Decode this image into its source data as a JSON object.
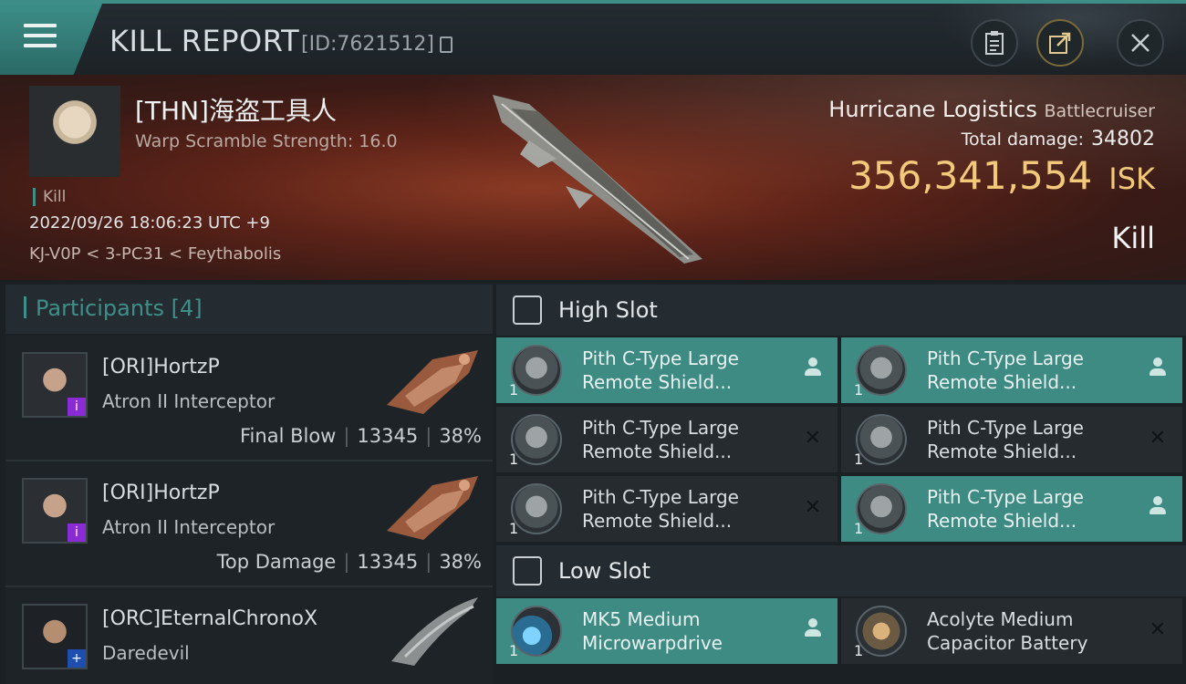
{
  "header": {
    "title": "KILL REPORT",
    "report_id": "[ID:7621512]",
    "icons": [
      "menu-icon",
      "clipboard-icon",
      "share-icon",
      "close-icon"
    ]
  },
  "victim": {
    "name": "[THN]海盗工具人",
    "scramble": "Warp Scramble Strength: 16.0",
    "tag": "Kill",
    "date": "2022/09/26 18:06:23 UTC +9",
    "location": "KJ-V0P < 3-PC31 < Feythabolis",
    "ship_name": "Hurricane Logistics",
    "ship_class": "Battlecruiser",
    "total_damage_label": "Total damage:",
    "total_damage": "34802",
    "isk_value": "356,341,554",
    "isk_unit": "ISK",
    "result": "Kill"
  },
  "participants": {
    "label": "Participants",
    "count": "[4]",
    "rows": [
      {
        "name": "[ORI]HortzP",
        "ship": "Atron II Interceptor",
        "role": "Final Blow",
        "damage": "13345",
        "percent": "38%",
        "badge": "i"
      },
      {
        "name": "[ORI]HortzP",
        "ship": "Atron II Interceptor",
        "role": "Top Damage",
        "damage": "13345",
        "percent": "38%",
        "badge": "i"
      },
      {
        "name": "[ORC]EternalChronoX",
        "ship": "Daredevil",
        "role": "",
        "damage": "",
        "percent": "",
        "badge": "+"
      }
    ]
  },
  "high_slot": {
    "title": "High Slot",
    "modules": [
      {
        "line1": "Pith C-Type Large",
        "line2": "Remote Shield...",
        "qty": "1",
        "status": "fitted"
      },
      {
        "line1": "Pith C-Type Large",
        "line2": "Remote Shield...",
        "qty": "1",
        "status": "fitted"
      },
      {
        "line1": "Pith C-Type Large",
        "line2": "Remote Shield...",
        "qty": "1",
        "status": "destroyed"
      },
      {
        "line1": "Pith C-Type Large",
        "line2": "Remote Shield...",
        "qty": "1",
        "status": "destroyed"
      },
      {
        "line1": "Pith C-Type Large",
        "line2": "Remote Shield...",
        "qty": "1",
        "status": "destroyed"
      },
      {
        "line1": "Pith C-Type Large",
        "line2": "Remote Shield...",
        "qty": "1",
        "status": "fitted"
      }
    ]
  },
  "low_slot": {
    "title": "Low Slot",
    "modules": [
      {
        "line1": "MK5 Medium",
        "line2": "Microwarpdrive",
        "qty": "1",
        "status": "fitted"
      },
      {
        "line1": "Acolyte Medium",
        "line2": "Capacitor Battery",
        "qty": "1",
        "status": "destroyed"
      }
    ]
  },
  "status_glyph": {
    "destroyed": "✕"
  },
  "colors": {
    "accent": "#3e8d86",
    "isk": "#f2c878",
    "fitted_bg": "#3e8b84"
  }
}
